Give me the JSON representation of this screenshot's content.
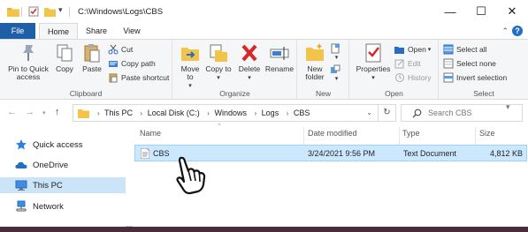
{
  "window": {
    "title": "C:\\Windows\\Logs\\CBS",
    "controls": {
      "minimize": "—",
      "maximize": "☐",
      "close": "✕"
    }
  },
  "tabs": {
    "file": "File",
    "home": "Home",
    "share": "Share",
    "view": "View"
  },
  "ribbon": {
    "clipboard": {
      "label": "Clipboard",
      "pin": "Pin to Quick access",
      "copy": "Copy",
      "paste": "Paste",
      "cut": "Cut",
      "copy_path": "Copy path",
      "paste_shortcut": "Paste shortcut"
    },
    "organize": {
      "label": "Organize",
      "move_to": "Move to",
      "copy_to": "Copy to",
      "delete": "Delete",
      "rename": "Rename"
    },
    "new": {
      "label": "New",
      "new_folder": "New folder"
    },
    "open": {
      "label": "Open",
      "properties": "Properties",
      "open": "Open",
      "edit": "Edit",
      "history": "History"
    },
    "select": {
      "label": "Select",
      "select_all": "Select all",
      "select_none": "Select none",
      "invert": "Invert selection"
    }
  },
  "address": {
    "crumbs": [
      "This PC",
      "Local Disk (C:)",
      "Windows",
      "Logs",
      "CBS"
    ]
  },
  "search": {
    "placeholder": "Search CBS"
  },
  "nav_pane": {
    "items": [
      {
        "label": "Quick access",
        "icon": "star-icon"
      },
      {
        "label": "OneDrive",
        "icon": "cloud-icon"
      },
      {
        "label": "This PC",
        "icon": "computer-icon"
      },
      {
        "label": "Network",
        "icon": "network-icon"
      }
    ]
  },
  "file_list": {
    "columns": {
      "name": "Name",
      "date": "Date modified",
      "type": "Type",
      "size": "Size"
    },
    "rows": [
      {
        "name": "CBS",
        "date": "3/24/2021 9:56 PM",
        "type": "Text Document",
        "size": "4,812 KB"
      }
    ]
  },
  "colors": {
    "accent": "#1f5fa8",
    "selection": "#cce8ff",
    "nav_selection": "#cce4f7",
    "delete_red": "#d8262b",
    "folder": "#f3c44a"
  }
}
